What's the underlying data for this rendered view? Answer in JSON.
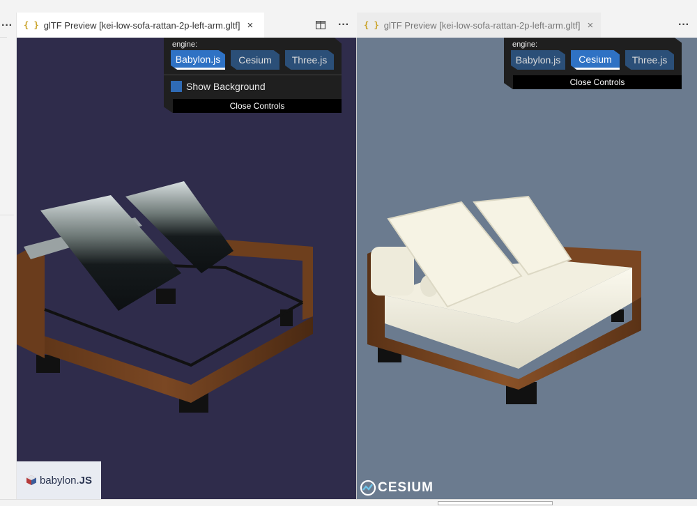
{
  "editor": {
    "left_tab": {
      "label": "glTF Preview [kei-low-sofa-rattan-2p-left-arm.gltf]",
      "icon": "braces-icon",
      "close": "×",
      "state": "active"
    },
    "right_tab": {
      "label": "glTF Preview [kei-low-sofa-rattan-2p-left-arm.gltf]",
      "icon": "braces-icon",
      "close": "×",
      "state": "inactive"
    },
    "more_actions": "···",
    "split_icon": "split-editor-icon"
  },
  "left_viewer": {
    "engine_label": "engine:",
    "engines": [
      "Babylon.js",
      "Cesium",
      "Three.js"
    ],
    "selected_engine": "Babylon.js",
    "show_background_label": "Show Background",
    "show_background_checked": true,
    "close_controls_label": "Close Controls",
    "logo_text_a": "babylon.",
    "logo_text_b": "JS",
    "background_color": "#2f2c4b"
  },
  "right_viewer": {
    "engine_label": "engine:",
    "engines": [
      "Babylon.js",
      "Cesium",
      "Three.js"
    ],
    "selected_engine": "Cesium",
    "close_controls_label": "Close Controls",
    "logo_text": "CESIUM",
    "background_color": "#6b7b8f"
  }
}
